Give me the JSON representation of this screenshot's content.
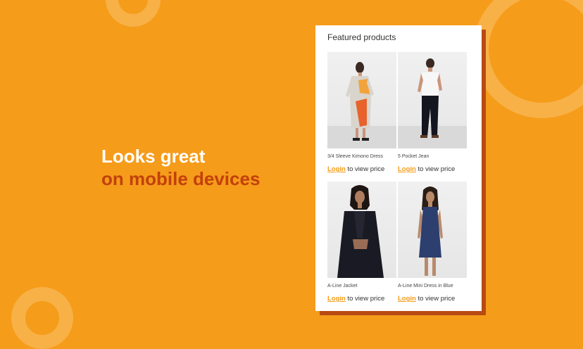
{
  "headline": {
    "line1": "Looks great",
    "line2": "on mobile devices"
  },
  "phone": {
    "title": "Featured products",
    "products": [
      {
        "name": "3/4 Sleeve Kimono Dress",
        "login_label": "Login",
        "price_suffix": " to view price"
      },
      {
        "name": "5 Pocket Jean",
        "login_label": "Login",
        "price_suffix": " to view price"
      },
      {
        "name": "A-Line Jacket",
        "login_label": "Login",
        "price_suffix": " to view price"
      },
      {
        "name": "A-Line Mini Dress in Blue",
        "login_label": "Login",
        "price_suffix": " to view price"
      }
    ]
  },
  "colors": {
    "background": "#f59c1a",
    "accent_dark": "#c2410c",
    "login_link": "#f59c1a",
    "card_shadow": "#b94a12"
  }
}
